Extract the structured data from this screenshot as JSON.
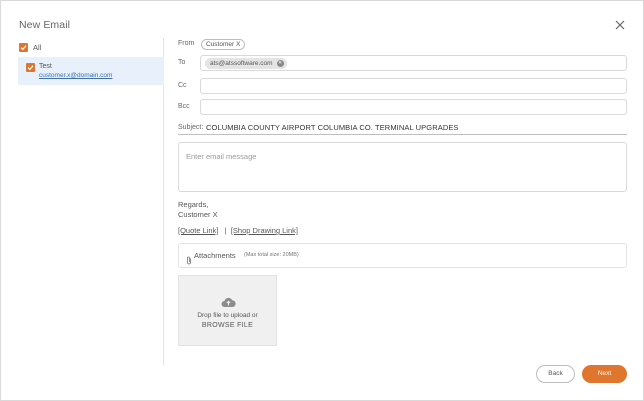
{
  "dialog": {
    "title": "New Email"
  },
  "recipients": {
    "all_label": "All",
    "contacts": [
      {
        "name": "Test",
        "email": "customer.x@domain.com",
        "checked": true
      }
    ]
  },
  "form": {
    "from_label": "From",
    "from_value": "Customer X",
    "to_label": "To",
    "to_chip": "ats@atssoftware.com",
    "cc_label": "Cc",
    "bcc_label": "Bcc",
    "subject_label": "Subject:",
    "subject_value": "COLUMBIA COUNTY AIRPORT COLUMBIA CO. TERMINAL UPGRADES",
    "message_placeholder": "Enter email message",
    "regards_line1": "Regards,",
    "regards_line2": "Customer X",
    "quote_link": "[Quote Link]",
    "link_separator": "|",
    "drawing_link": "[Shop Drawing Link]"
  },
  "attachments": {
    "title": "Attachments",
    "max_size": "(Max total size: 20MB)",
    "drop_text": "Drop file to upload or",
    "browse_text": "BROWSE FILE"
  },
  "actions": {
    "back_label": "Back",
    "next_label": "Next"
  },
  "colors": {
    "accent": "#e0762d",
    "selected_row": "#e8f1fb",
    "link": "#3a6fb0"
  },
  "icons": [
    "close-icon",
    "checkbox-checked-icon",
    "remove-chip-icon",
    "paperclip-icon",
    "cloud-upload-icon"
  ]
}
